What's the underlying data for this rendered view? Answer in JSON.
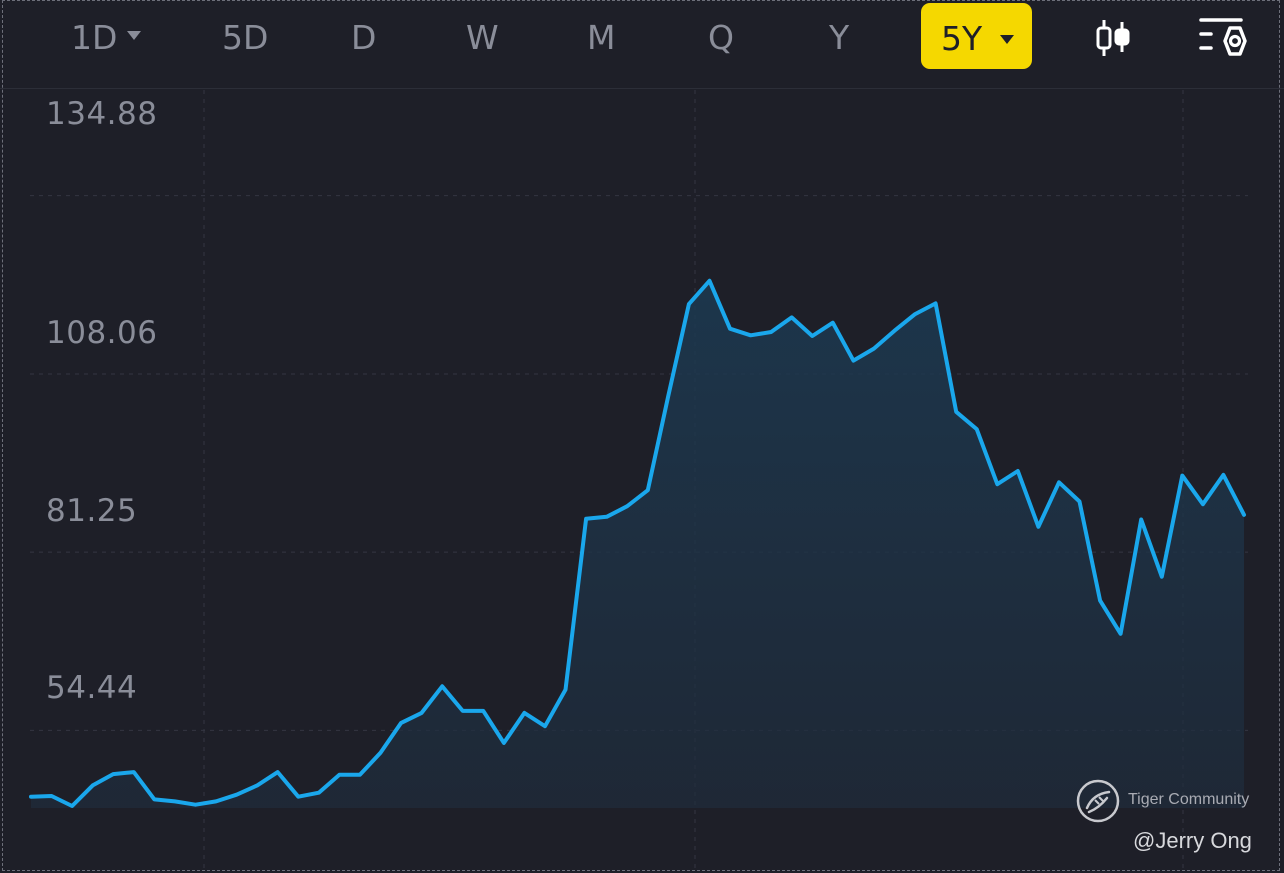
{
  "toolbar": {
    "tabs": [
      "1D",
      "5D",
      "D",
      "W",
      "M",
      "Q",
      "Y"
    ],
    "active_tab": "5Y",
    "icons": [
      "candlestick-icon",
      "settings-icon"
    ],
    "active_color": "#f5d800"
  },
  "chart_data": {
    "type": "area",
    "title": "",
    "xlabel": "",
    "ylabel": "",
    "y_ticks": [
      "134.88",
      "108.06",
      "81.25",
      "54.44"
    ],
    "ylim": [
      36.0,
      142.5
    ],
    "grid": true,
    "line_color": "#1aa7ec",
    "x": [
      0,
      1,
      2,
      3,
      4,
      5,
      6,
      7,
      8,
      9,
      10,
      11,
      12,
      13,
      14,
      15,
      16,
      17,
      18,
      19,
      20,
      21,
      22,
      23,
      24,
      25,
      26,
      27,
      28,
      29,
      30,
      31,
      32,
      33,
      34,
      35,
      36,
      37,
      38,
      39,
      40,
      41,
      42,
      43,
      44,
      45,
      46,
      47,
      48,
      49,
      50,
      51,
      52,
      53,
      54,
      55,
      56,
      57,
      58,
      59,
      60
    ],
    "values": [
      37.7,
      37.8,
      36.3,
      39.4,
      41.1,
      41.4,
      37.3,
      37.0,
      36.5,
      37.0,
      38.0,
      39.4,
      41.4,
      37.7,
      38.3,
      41.0,
      41.0,
      44.3,
      48.8,
      50.3,
      54.3,
      50.6,
      50.6,
      45.8,
      50.3,
      48.3,
      53.8,
      79.5,
      79.8,
      81.4,
      83.8,
      98.0,
      111.8,
      115.3,
      108.1,
      107.1,
      107.6,
      109.8,
      107.0,
      109.0,
      103.3,
      105.1,
      107.8,
      110.3,
      111.9,
      95.6,
      93.0,
      84.7,
      86.7,
      78.3,
      85.0,
      82.1,
      67.2,
      62.2,
      79.4,
      70.8,
      86.0,
      81.7,
      86.1,
      80.1
    ]
  },
  "watermark": {
    "brand": "Tiger Community",
    "author": "@Jerry Ong"
  }
}
